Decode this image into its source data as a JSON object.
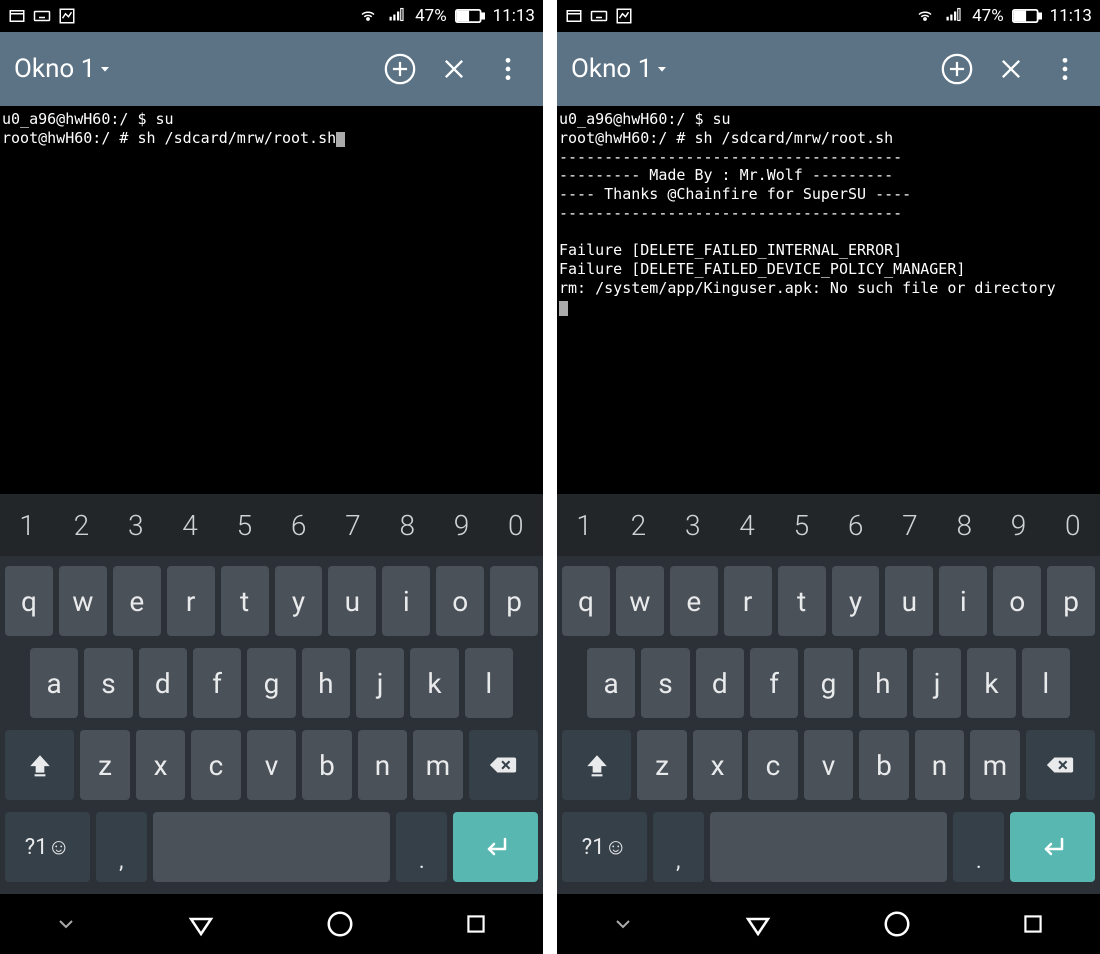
{
  "status": {
    "battery_pct": "47%",
    "time": "11:13"
  },
  "header": {
    "title": "Okno 1"
  },
  "terminal": {
    "left": [
      "u0_a96@hwH60:/ $ su",
      "root@hwH60:/ # sh /sdcard/mrw/root.sh"
    ],
    "right": [
      "u0_a96@hwH60:/ $ su",
      "root@hwH60:/ # sh /sdcard/mrw/root.sh",
      "--------------------------------------",
      "--------- Made By : Mr.Wolf ---------",
      "---- Thanks @Chainfire for SuperSU ----",
      "--------------------------------------",
      "",
      "Failure [DELETE_FAILED_INTERNAL_ERROR]",
      "Failure [DELETE_FAILED_DEVICE_POLICY_MANAGER]",
      "rm: /system/app/Kinguser.apk: No such file or directory"
    ]
  },
  "keyboard": {
    "numrow": [
      "1",
      "2",
      "3",
      "4",
      "5",
      "6",
      "7",
      "8",
      "9",
      "0"
    ],
    "row1": [
      "q",
      "w",
      "e",
      "r",
      "t",
      "y",
      "u",
      "i",
      "o",
      "p"
    ],
    "row2": [
      "a",
      "s",
      "d",
      "f",
      "g",
      "h",
      "j",
      "k",
      "l"
    ],
    "row3": [
      "z",
      "x",
      "c",
      "v",
      "b",
      "n",
      "m"
    ],
    "symkey": "?1☺",
    "comma": ",",
    "dot": "."
  }
}
